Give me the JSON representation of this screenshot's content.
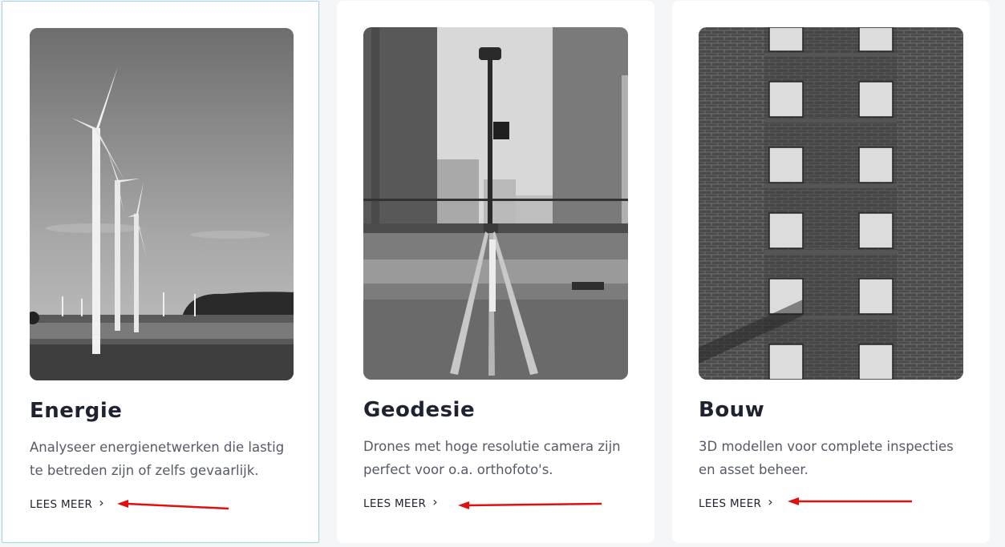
{
  "cards": [
    {
      "title": "Energie",
      "description": "Analyseer energienetwerken die lastig te betreden zijn of zelfs gevaarlijk.",
      "link_label": "LEES MEER",
      "link_icon": "chevron-right-icon",
      "image": "wind-turbines-photo"
    },
    {
      "title": "Geodesie",
      "description": "Drones met hoge resolutie camera zijn perfect voor o.a. orthofoto's.",
      "link_label": "LEES MEER",
      "link_icon": "chevron-right-icon",
      "image": "survey-tripod-photo"
    },
    {
      "title": "Bouw",
      "description": "3D modellen voor complete inspecties en asset beheer.",
      "link_label": "LEES MEER",
      "link_icon": "chevron-right-icon",
      "image": "brick-building-photo"
    }
  ],
  "annotation_color": "#e01010",
  "selected_card_border": "#9fd3e6"
}
